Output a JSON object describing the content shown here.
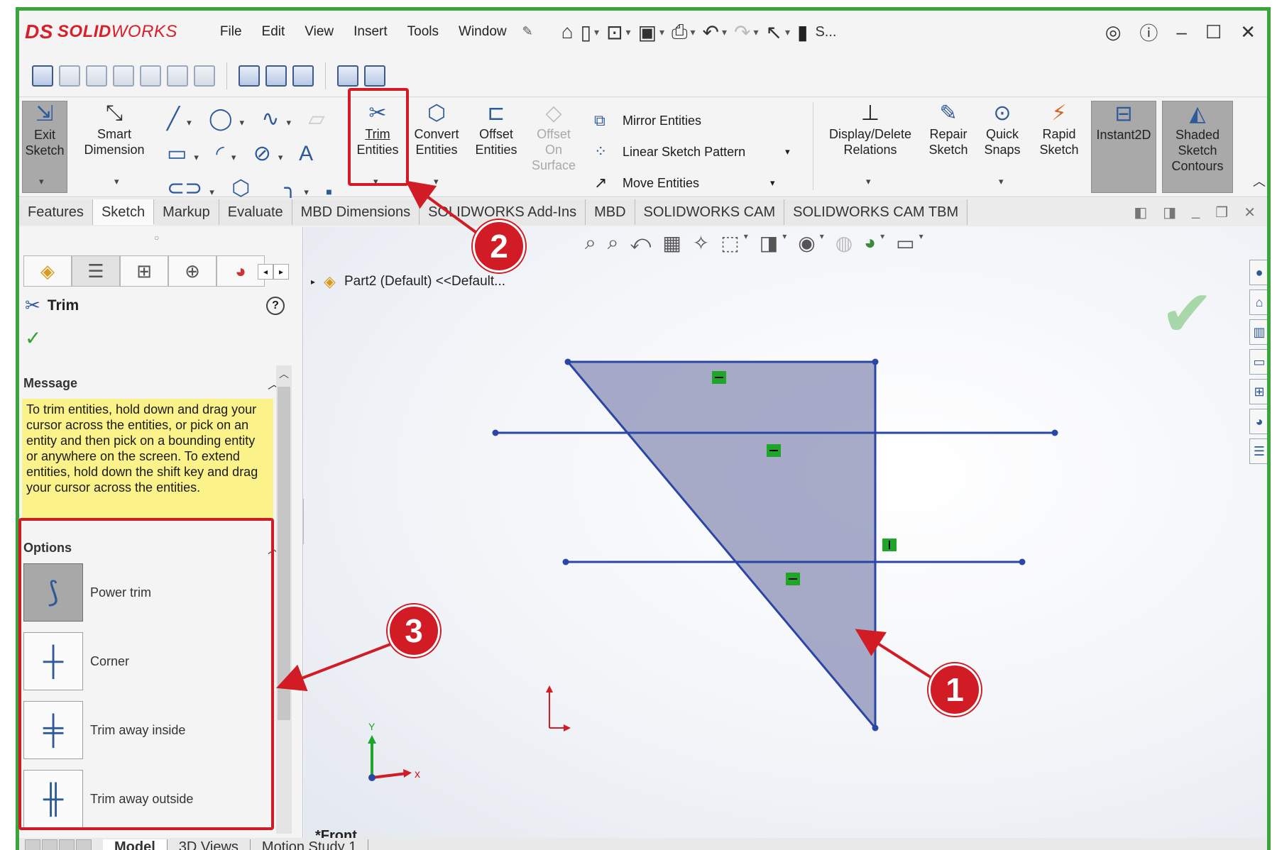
{
  "app": {
    "logo_ds": "DS",
    "logo_solid": "SOLID",
    "logo_works": "WORKS"
  },
  "menu": [
    "File",
    "Edit",
    "View",
    "Insert",
    "Tools",
    "Window"
  ],
  "title_search_short": "S...",
  "command_manager": {
    "exit_sketch": [
      "Exit",
      "Sketch"
    ],
    "smart_dimension": [
      "Smart",
      "Dimension"
    ],
    "trim_entities": [
      "Trim",
      "Entities"
    ],
    "convert_entities": [
      "Convert",
      "Entities"
    ],
    "offset_entities": [
      "Offset",
      "Entities"
    ],
    "offset_on_surface": [
      "Offset",
      "On",
      "Surface"
    ],
    "mirror_entities": "Mirror Entities",
    "linear_sketch_pattern": "Linear Sketch Pattern",
    "move_entities": "Move Entities",
    "display_delete_relations": [
      "Display/Delete",
      "Relations"
    ],
    "repair_sketch": [
      "Repair",
      "Sketch"
    ],
    "quick_snaps": [
      "Quick",
      "Snaps"
    ],
    "rapid_sketch": [
      "Rapid",
      "Sketch"
    ],
    "instant2d": "Instant2D",
    "shaded_sketch_contours": [
      "Shaded",
      "Sketch",
      "Contours"
    ]
  },
  "tabs": [
    "Features",
    "Sketch",
    "Markup",
    "Evaluate",
    "MBD Dimensions",
    "SOLIDWORKS Add-Ins",
    "MBD",
    "SOLIDWORKS CAM",
    "SOLIDWORKS CAM TBM"
  ],
  "active_tab": "Sketch",
  "property_manager": {
    "title": "Trim",
    "message_header": "Message",
    "message_text": "To trim entities, hold down and drag your cursor across the entities, or pick on an entity and then pick on a bounding entity or anywhere on the screen.  To extend entities, hold down the shift key and drag your cursor across the entities.",
    "options_header": "Options",
    "options": [
      "Power trim",
      "Corner",
      "Trim away inside",
      "Trim away outside"
    ]
  },
  "graphics": {
    "tree_label": "Part2 (Default) <<Default...",
    "view_label": "*Front",
    "axis_x": "x",
    "axis_y": "Y"
  },
  "bottom_tabs": [
    "Model",
    "3D Views",
    "Motion Study 1"
  ],
  "callouts": [
    "1",
    "2",
    "3"
  ],
  "colors": {
    "accent_red": "#d11b25",
    "sketch_blue": "#2b46a6",
    "frame_green": "#3aa53a",
    "message_yellow": "#fbf28a",
    "region_fill": "#8a8fb6"
  }
}
